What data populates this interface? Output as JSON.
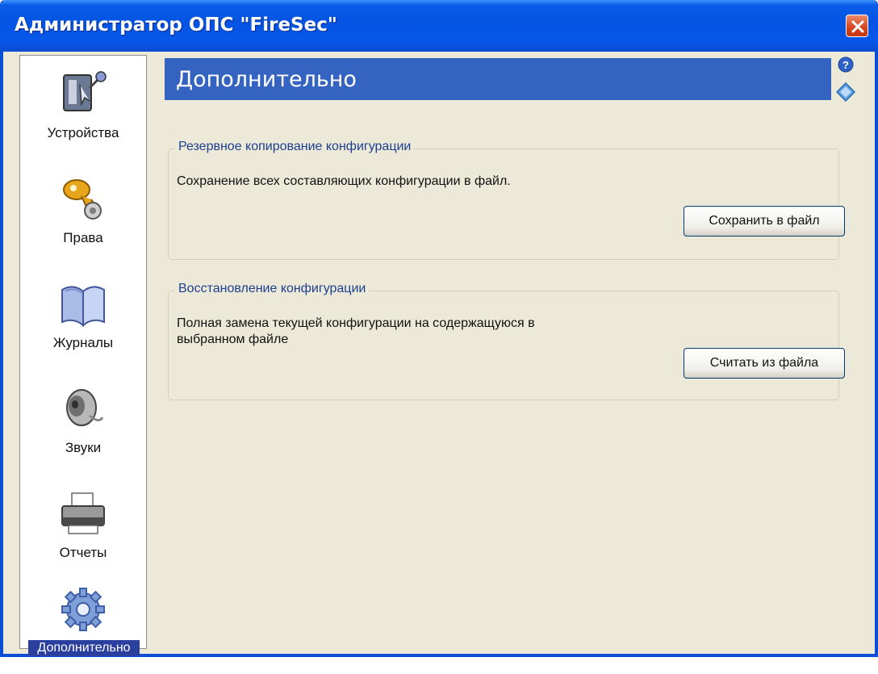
{
  "window": {
    "title": "Администратор ОПС \"FireSec\""
  },
  "sidebar": {
    "items": [
      {
        "label": "Устройства",
        "icon": "devices-icon"
      },
      {
        "label": "Права",
        "icon": "keys-icon"
      },
      {
        "label": "Журналы",
        "icon": "book-icon"
      },
      {
        "label": "Звуки",
        "icon": "speaker-icon"
      },
      {
        "label": "Отчеты",
        "icon": "printer-icon"
      },
      {
        "label": "Дополнительно",
        "icon": "gear-icon",
        "active": true
      }
    ]
  },
  "header": {
    "title": "Дополнительно"
  },
  "backup": {
    "title": "Резервное копирование конфигурации",
    "description": "Сохранение всех составляющих конфигурации в файл.",
    "button_label": "Сохранить в файл"
  },
  "restore": {
    "title": "Восстановление конфигурации",
    "description_line1": "Полная замена текущей конфигурации на содержащуюся в",
    "description_line2": "выбранном файле",
    "button_label": "Считать из файла"
  },
  "colors": {
    "titlebar": "#0554e3",
    "banner": "#3563c1",
    "active_item": "#2a3f9e",
    "background": "#ece9d8",
    "close_button": "#d6441d"
  }
}
